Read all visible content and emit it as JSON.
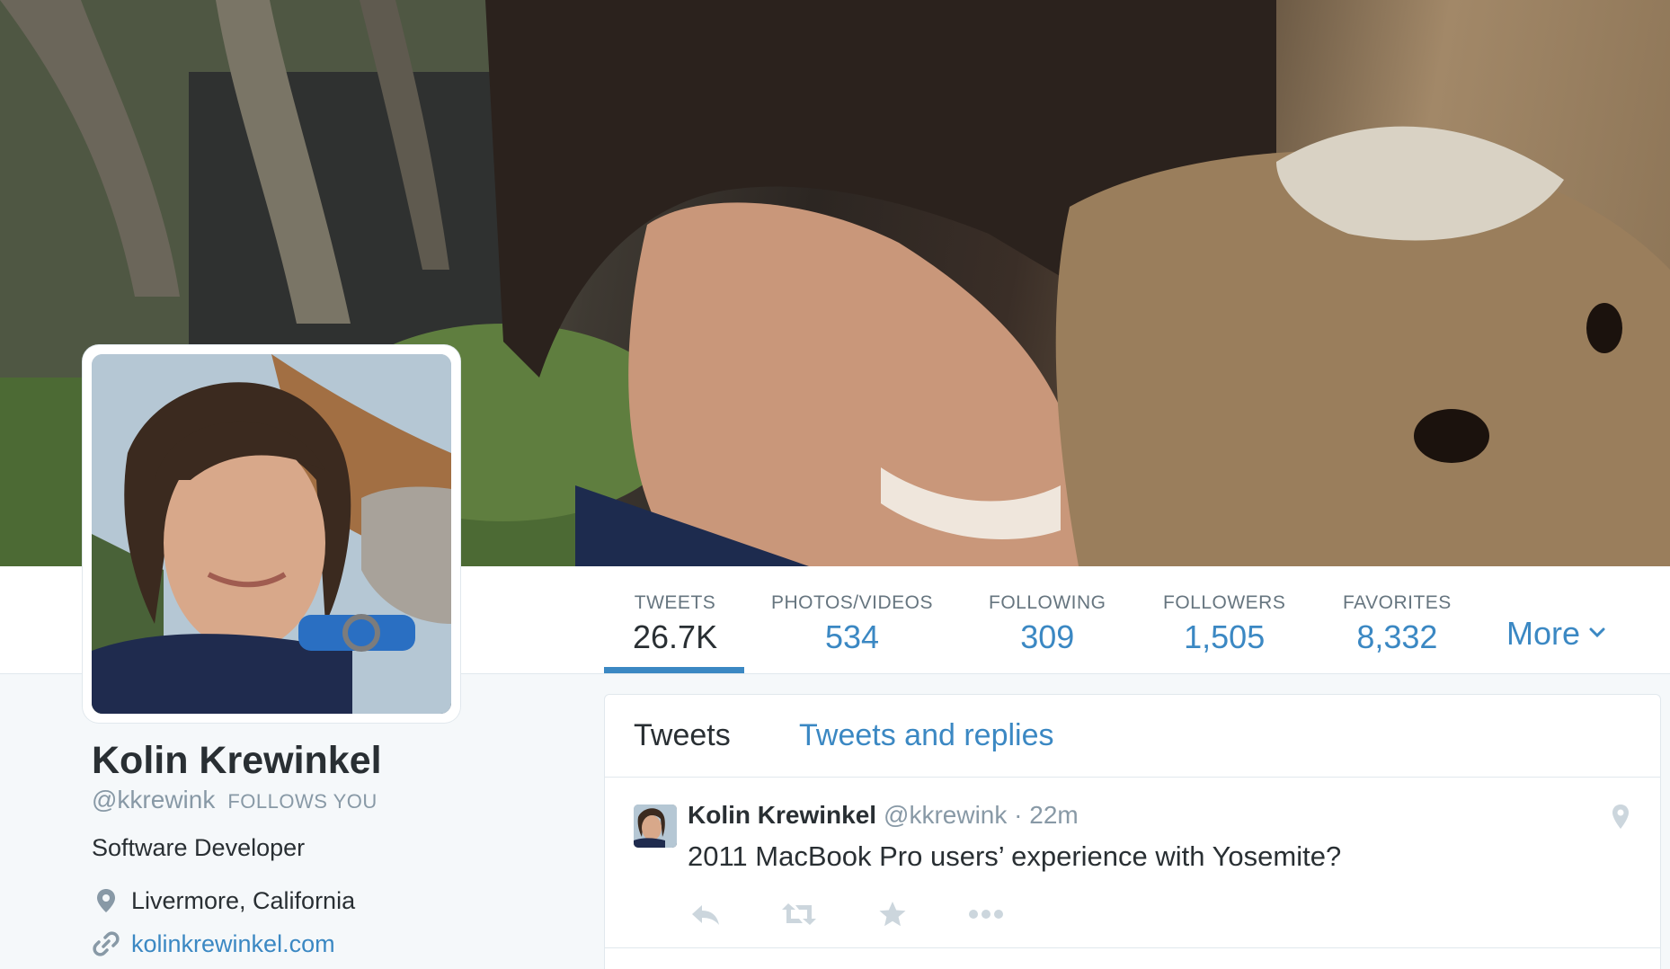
{
  "profile": {
    "name": "Kolin Krewinkel",
    "handle": "@kkrewink",
    "follows_you": "FOLLOWS YOU",
    "bio": "Software Developer",
    "location": "Livermore, California",
    "website": "kolinkrewinkel.com"
  },
  "nav": {
    "stats": [
      {
        "label": "TWEETS",
        "value": "26.7K"
      },
      {
        "label": "PHOTOS/VIDEOS",
        "value": "534"
      },
      {
        "label": "FOLLOWING",
        "value": "309"
      },
      {
        "label": "FOLLOWERS",
        "value": "1,505"
      },
      {
        "label": "FAVORITES",
        "value": "8,332"
      }
    ],
    "more_label": "More"
  },
  "timeline": {
    "tabs": [
      {
        "label": "Tweets"
      },
      {
        "label": "Tweets and replies"
      }
    ],
    "tweets": [
      {
        "name": "Kolin Krewinkel",
        "handle": "@kkrewink",
        "time": " · 22m",
        "text": "2011 MacBook Pro users’ experience with Yosemite?"
      }
    ]
  },
  "colors": {
    "accent": "#3b88c3",
    "text": "#292f33",
    "muted": "#8899a6",
    "background": "#f5f8fa"
  },
  "icons": {
    "location": "map-pin-icon",
    "website": "link-icon",
    "more": "chevron-down-icon",
    "reply": "reply-icon",
    "retweet": "retweet-icon",
    "favorite": "star-icon",
    "overflow": "ellipsis-icon",
    "geo": "map-pin-icon"
  }
}
